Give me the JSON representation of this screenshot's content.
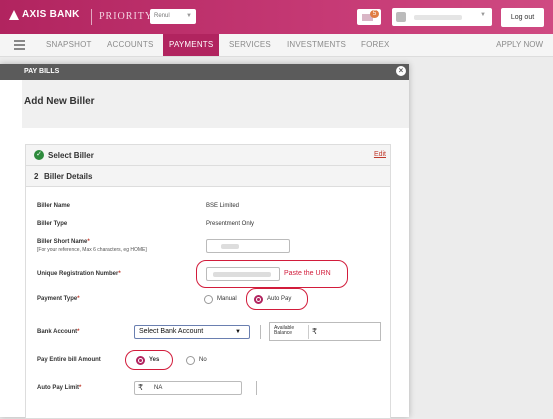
{
  "header": {
    "brand": "AXIS BANK",
    "tier": "PRIORITY",
    "language": "Renul",
    "mail_count": "5",
    "logout_label": "Log out"
  },
  "nav": {
    "items": [
      "SNAPSHOT",
      "ACCOUNTS",
      "PAYMENTS",
      "SERVICES",
      "INVESTMENTS",
      "FOREX"
    ],
    "active": "PAYMENTS",
    "apply": "APPLY NOW"
  },
  "modal": {
    "title": "PAY BILLS",
    "close_icon": "close-icon",
    "page_title": "Add New Biller",
    "step1": {
      "title": "Select Biller",
      "edit": "Edit"
    },
    "step2": {
      "number": "2",
      "title": "Biller Details"
    },
    "fields": {
      "biller_name_label": "Biller Name",
      "biller_name_value": "BSE Limited",
      "biller_type_label": "Biller Type",
      "biller_type_value": "Presentment Only",
      "short_name_label": "Biller Short Name",
      "short_name_hint": "[For your reference, Max 6 characters, eg HOME]",
      "urn_label": "Unique Registration Number",
      "urn_note": "Paste the URN",
      "payment_type_label": "Payment Type",
      "payment_type_options": [
        "Manual",
        "Auto Pay"
      ],
      "payment_type_selected": "Auto Pay",
      "bank_account_label": "Bank Account",
      "bank_account_placeholder": "Select Bank Account",
      "available_balance_label": "Available Balance",
      "currency": "₹",
      "pay_entire_label": "Pay Entire bill Amount",
      "pay_entire_options": [
        "Yes",
        "No"
      ],
      "pay_entire_selected": "Yes",
      "auto_pay_limit_label": "Auto Pay Limit",
      "auto_pay_limit_value": "NA",
      "required_mark": "*"
    }
  },
  "colors": {
    "brand": "#b1245f",
    "highlight": "#d21c3b",
    "success": "#2d8a3c"
  }
}
